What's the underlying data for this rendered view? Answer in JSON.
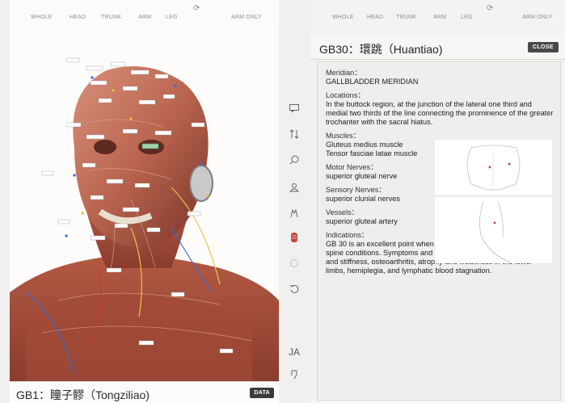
{
  "nav": {
    "whole": "WHOLE",
    "head": "HEAD",
    "trunk": "TRUNK",
    "arm": "ARM",
    "leg": "LEG",
    "arm_only": "ARM ONLY"
  },
  "left": {
    "point_title": "GB1：瞳子髎（Tongziliao)",
    "data_label": "DATA"
  },
  "toolbar": {
    "lang_label": "JA"
  },
  "detail": {
    "title": "GB30：環跳（Huantiao)",
    "close_label": "CLOSE",
    "meridian_label": "Meridian：",
    "meridian_value": "GALLBLADDER MERIDIAN",
    "locations_label": "Locations：",
    "locations_value": "In the buttock region, at the junction of the lateral one third and medial two thirds of the line connecting the prominence of the greater trochanter with the sacral hiatus.",
    "muscles_label": "Muscles：",
    "muscles_value_1": "Gluteus medius muscle",
    "muscles_value_2": "Tensor fasciae latae muscle",
    "motor_label": "Motor Nerves：",
    "motor_value": "superior gluteal nerve",
    "sensory_label": "Sensory Nerves：",
    "sensory_value": "superior clunial nerves",
    "vessels_label": "Vessels：",
    "vessels_value": "superior gluteal artery",
    "indications_label": "Indications：",
    "indications_value": "GB 30 is an excellent point when used to treat treat hip and lower spine conditions. Symptoms and conditions include sciatica, hip pain and stiffness, osteoarthritis, atrophy and weakness in the lower limbs, hemiplegia, and lymphatic blood stagnation."
  },
  "colors": {
    "muscle": "#b8644f",
    "skin_dark": "#8a3c2e",
    "data_btn": "#3b3b3b",
    "close_btn": "#4a4a4a",
    "highlight_label": "#9fd3a8"
  },
  "icons": [
    "comment-icon",
    "sort-icon",
    "search-icon",
    "person-icon",
    "body-layers-icon",
    "muscle-icon",
    "refresh-icon",
    "undo-icon",
    "hand-icon"
  ]
}
